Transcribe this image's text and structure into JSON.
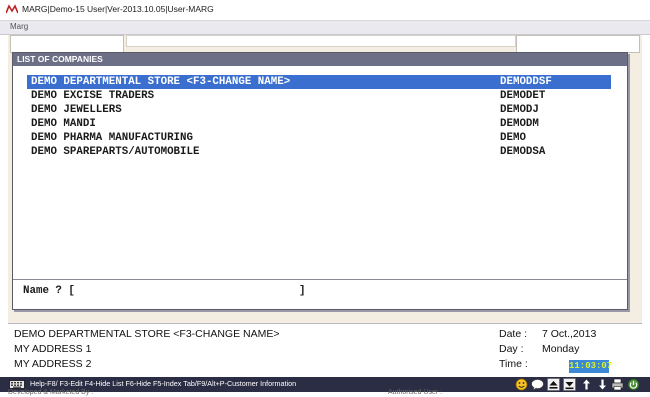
{
  "window": {
    "title": "MARG|Demo-15 User|Ver-2013.10.05|User-MARG"
  },
  "menubar": {
    "label": "Marg"
  },
  "dialog": {
    "title": "LIST OF COMPANIES",
    "companies": [
      {
        "name": "DEMO DEPARTMENTAL STORE <F3-CHANGE NAME>",
        "code": "DEMODDSF",
        "selected": true
      },
      {
        "name": "DEMO EXCISE TRADERS",
        "code": "DEMODET",
        "selected": false
      },
      {
        "name": "DEMO JEWELLERS",
        "code": "DEMODJ",
        "selected": false
      },
      {
        "name": "DEMO MANDI",
        "code": "DEMODM",
        "selected": false
      },
      {
        "name": "DEMO PHARMA MANUFACTURING",
        "code": "DEMO",
        "selected": false
      },
      {
        "name": "DEMO SPAREPARTS/AUTOMOBILE",
        "code": "DEMODSA",
        "selected": false
      }
    ],
    "name_prompt": "Name ? [",
    "name_close": "]",
    "name_value": ""
  },
  "info": {
    "company": "DEMO DEPARTMENTAL STORE <F3-CHANGE NAME>",
    "address1": "MY ADDRESS 1",
    "address2": "MY ADDRESS 2",
    "date_label": "Date  :",
    "date_value": "7 Oct.,2013",
    "day_label": "Day  :",
    "day_value": "Monday",
    "time_label": "Time  :",
    "time_value": "11:03:07"
  },
  "statusbar": {
    "help_text": "Help-F8/ F3-Edit F4-Hide List F6-Hide F5-Index Tab/F9/Alt+P-Customer Information"
  },
  "footer": {
    "left_text": "Developed & Marketed By :",
    "right_text": "Authorised User :"
  },
  "colors": {
    "selection": "#3a6fd0",
    "dialog_title_bg": "#6d6f86",
    "statusbar_bg": "#2b2d44"
  }
}
